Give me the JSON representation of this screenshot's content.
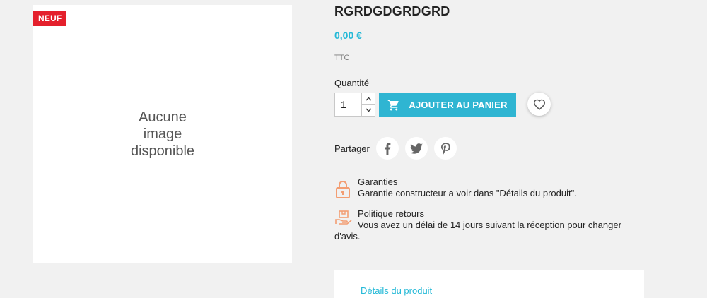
{
  "product": {
    "badge": "NEUF",
    "no_image_text": "Aucune image disponible",
    "title": "RGRDGDGRDGRD",
    "price": "0,00 €",
    "tax_label": "TTC"
  },
  "quantity": {
    "label": "Quantité",
    "value": "1"
  },
  "actions": {
    "add_to_cart_label": "AJOUTER AU PANIER"
  },
  "share": {
    "label": "Partager",
    "networks": [
      "facebook",
      "twitter",
      "pinterest"
    ]
  },
  "reassurance": [
    {
      "title": "Garanties",
      "text": "Garantie constructeur a voir dans \"Détails du produit\".",
      "icon": "lock-icon"
    },
    {
      "title": "Politique retours",
      "text": "Vous avez un délai de 14 jours suivant la réception pour changer d'avis.",
      "icon": "return-box-icon"
    }
  ],
  "tabs": {
    "details_label": "Détails du produit"
  },
  "colors": {
    "accent": "#2fb5d2",
    "price": "#24b9d7",
    "badge": "#e4202c",
    "reassurance_icon": "#f39d72"
  }
}
